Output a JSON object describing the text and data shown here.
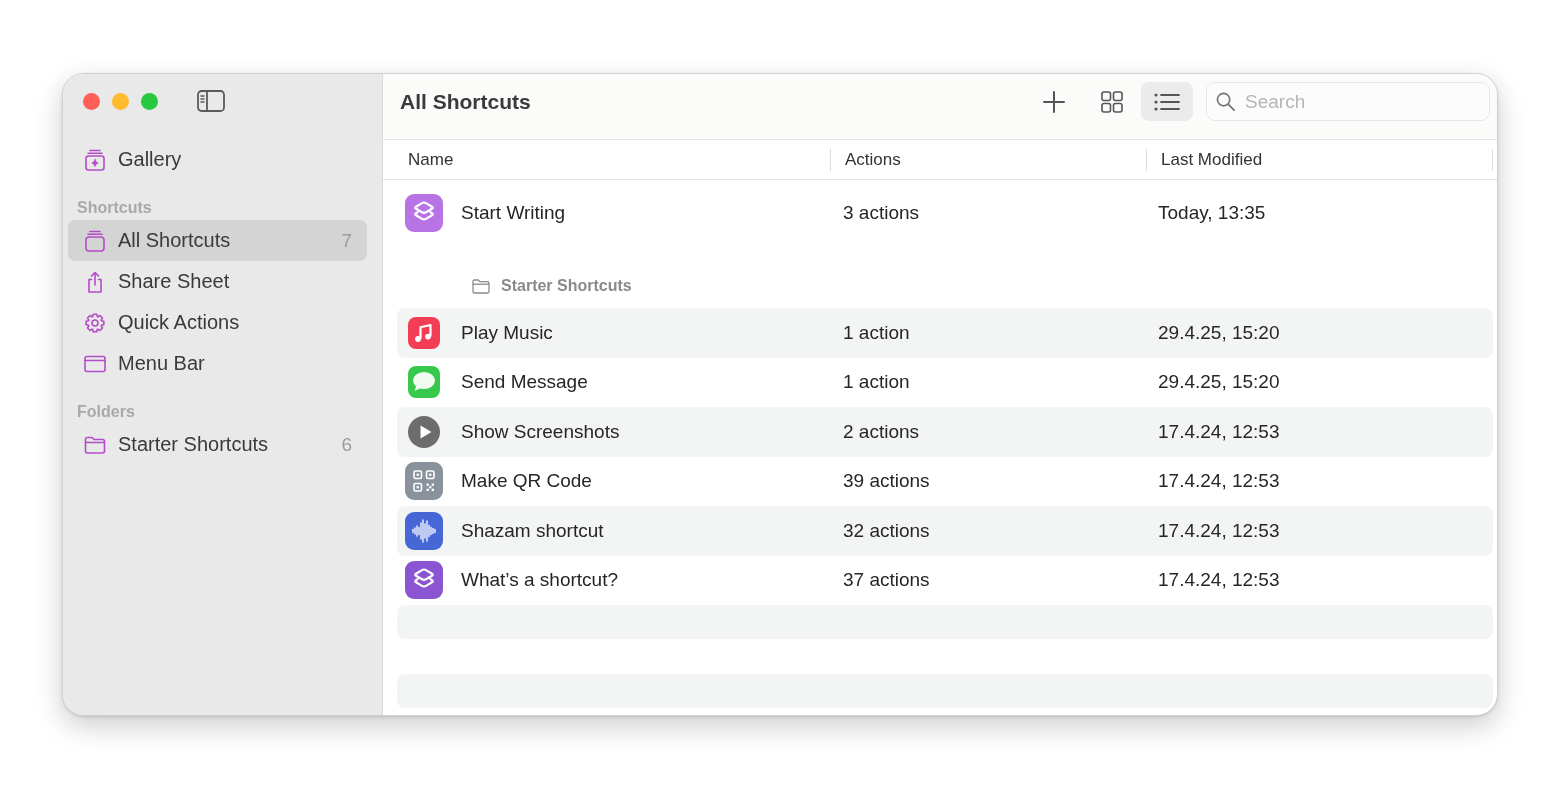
{
  "sidebar": {
    "items": [
      {
        "kind": "gallery",
        "label": "Gallery",
        "selected": false
      }
    ],
    "sections": [
      {
        "title": "Shortcuts",
        "items": [
          {
            "kind": "stack",
            "label": "All Shortcuts",
            "count": "7",
            "selected": true
          },
          {
            "kind": "share",
            "label": "Share Sheet",
            "selected": false
          },
          {
            "kind": "gear",
            "label": "Quick Actions",
            "selected": false
          },
          {
            "kind": "menubar",
            "label": "Menu Bar",
            "selected": false
          }
        ]
      },
      {
        "title": "Folders",
        "items": [
          {
            "kind": "folder",
            "label": "Starter Shortcuts",
            "count": "6",
            "selected": false
          }
        ]
      }
    ]
  },
  "toolbar": {
    "title": "All Shortcuts",
    "view_buttons": [
      {
        "kind": "grid",
        "selected": false
      },
      {
        "kind": "list",
        "selected": true
      }
    ],
    "search": {
      "placeholder": "Search"
    }
  },
  "table": {
    "columns": [
      "Name",
      "Actions",
      "Last Modified"
    ],
    "rows": [
      {
        "kind": "layers",
        "color": "#b873e4",
        "name": "Start Writing",
        "actions": "3 actions",
        "modified": "Today, 13:35"
      }
    ],
    "groups": [
      {
        "title": "Starter Shortcuts",
        "rows": [
          {
            "kind": "music",
            "color": "#f23d55",
            "name": "Play Music",
            "actions": "1 action",
            "modified": "29.4.25, 15:20"
          },
          {
            "kind": "message",
            "color": "#36c94c",
            "name": "Send Message",
            "actions": "1 action",
            "modified": "29.4.25, 15:20"
          },
          {
            "kind": "play",
            "color": "#6c6c6c",
            "name": "Show Screenshots",
            "actions": "2 actions",
            "modified": "17.4.24, 12:53"
          },
          {
            "kind": "qr",
            "color": "#8a929c",
            "name": "Make QR Code",
            "actions": "39 actions",
            "modified": "17.4.24, 12:53"
          },
          {
            "kind": "waveform",
            "color": "#4767d6",
            "name": "Shazam shortcut",
            "actions": "32 actions",
            "modified": "17.4.24, 12:53"
          },
          {
            "kind": "layers",
            "color": "#8b54d0",
            "name": "What’s a shortcut?",
            "actions": "37 actions",
            "modified": "17.4.24, 12:53"
          }
        ]
      }
    ]
  }
}
